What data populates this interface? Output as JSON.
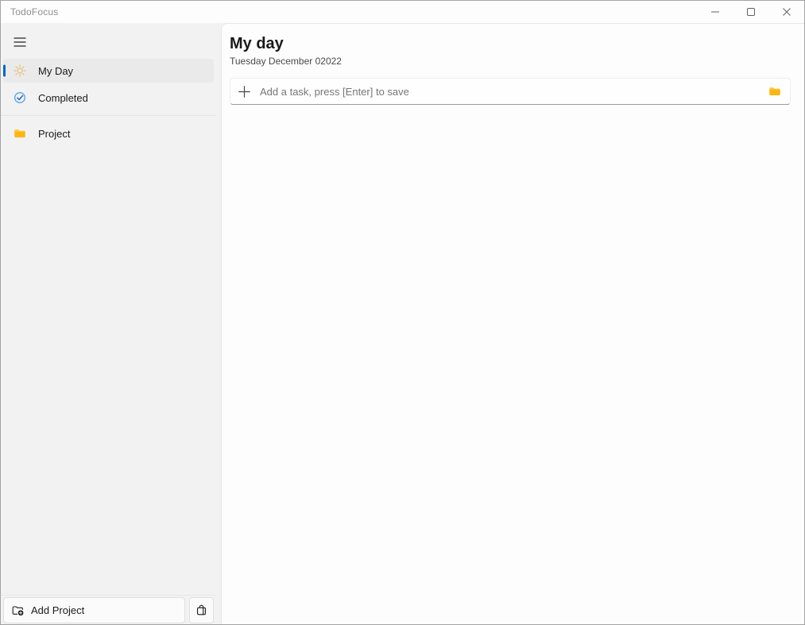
{
  "titlebar": {
    "app_title": "TodoFocus",
    "controls": {
      "minimize": "minimize",
      "maximize": "maximize",
      "close": "close"
    }
  },
  "sidebar": {
    "menu_button": "hamburger-menu",
    "items": [
      {
        "label": "My Day",
        "icon": "sun-icon",
        "selected": true
      },
      {
        "label": "Completed",
        "icon": "check-circle-icon",
        "selected": false
      }
    ],
    "projects": [
      {
        "label": "Project",
        "icon": "folder-icon"
      }
    ],
    "footer": {
      "add_project_label": "Add Project",
      "add_project_icon": "folder-plus-icon",
      "bag_icon": "shopping-bag-icon"
    }
  },
  "main": {
    "title": "My day",
    "date": "Tuesday December 02022",
    "task_input": {
      "value": "",
      "placeholder": "Add a task, press [Enter] to save",
      "left_icon": "plus-icon",
      "right_icon": "folder-icon"
    }
  },
  "colors": {
    "accent_blue": "#0067C0",
    "folder_yellow": "#FBB612",
    "folder_yellow_light": "#FFC83D",
    "sun_gold": "#E6C285",
    "check_circle_blue": "#5AA8EE",
    "check_mark_blue": "#2B6BC4",
    "sidebar_bg": "#F2F2F2",
    "selected_item_bg": "#EAEAEA",
    "content_bg": "#FDFDFD"
  }
}
